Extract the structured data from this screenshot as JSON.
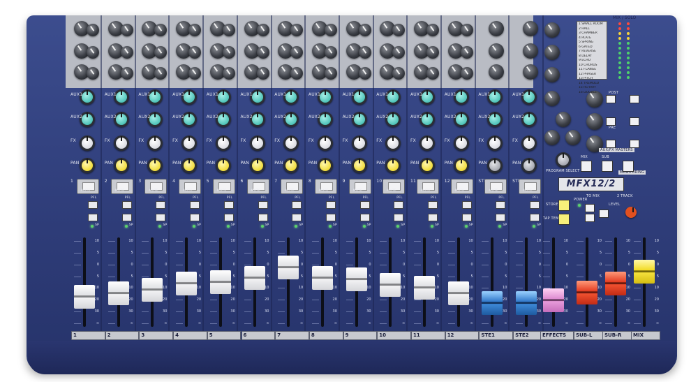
{
  "mixer": {
    "model_logo": "MFX12/2",
    "button_labels": {
      "mute": "MUTE",
      "pfl": "PFL",
      "fx": "FX",
      "pan": "PAN",
      "aux1": "AUX1",
      "aux2": "AUX2",
      "power": "POWER",
      "store": "STORE",
      "tap_tempo": "TAP TEMPO",
      "to_mix": "TO MIX",
      "two_track": "2 TRACK",
      "level": "LEVEL",
      "program_select": "PROGRAM SELECT",
      "aux_fx_masters": "AUX/FX MASTERS",
      "monitoring": "MONITORING",
      "mix": "MIX",
      "sub": "SUB",
      "post": "POST",
      "pre": "PRE",
      "sp": "SP"
    },
    "channel_numbers": [
      "1",
      "2",
      "3",
      "4",
      "5",
      "6",
      "7",
      "8",
      "9",
      "10",
      "11",
      "12",
      "STE1",
      "STE2",
      "FX"
    ],
    "fader_scale": [
      "10",
      "5",
      "0",
      "5",
      "10",
      "20",
      "30",
      "∞"
    ],
    "bottom_labels": [
      "1",
      "2",
      "3",
      "4",
      "5",
      "6",
      "7",
      "8",
      "9",
      "10",
      "11",
      "12",
      "STE1",
      "STE2",
      "EFFECTS",
      "SUB-L",
      "SUB-R",
      "MIX"
    ],
    "fader_levels": [
      0.28,
      0.33,
      0.38,
      0.48,
      0.5,
      0.56,
      0.72,
      0.56,
      0.54,
      0.46,
      0.42,
      0.33,
      0.18,
      0.18,
      0.22,
      0.34,
      0.48,
      0.66
    ],
    "fader_colors": [
      "white",
      "white",
      "white",
      "white",
      "white",
      "white",
      "white",
      "white",
      "white",
      "white",
      "white",
      "white",
      "blue",
      "blue",
      "pink",
      "red",
      "red",
      "yellow"
    ],
    "effects_programs": [
      "1 SMALL ROOM",
      "2 HALL",
      "3 CHAMBER",
      "4 PLATE",
      "5 SPRING",
      "6 GATED",
      "7 REVERSE",
      "8 DELAY",
      "9 ECHO",
      "10 CHORUS",
      "11 FLANGE",
      "12 PHASER",
      "13 PITCH",
      "14 TREMOLO",
      "15 ROTARY",
      "16 DOUBLE"
    ],
    "meter_label": "MIX / SOLO"
  }
}
